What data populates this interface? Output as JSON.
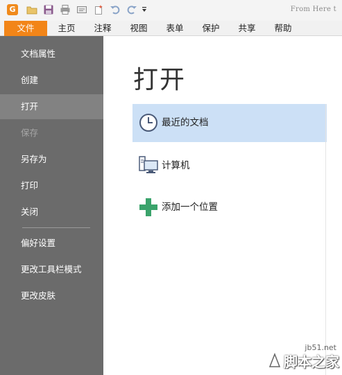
{
  "quick_access": {
    "app_logo_text": "G",
    "icons": [
      "folder-open-icon",
      "save-icon",
      "print-icon",
      "scan-icon",
      "new-document-icon",
      "undo-icon",
      "redo-icon",
      "customize-dropdown-icon"
    ],
    "hint": "From Here t"
  },
  "menu": {
    "tabs": [
      {
        "label": "文件",
        "active": true
      },
      {
        "label": "主页"
      },
      {
        "label": "注释"
      },
      {
        "label": "视图"
      },
      {
        "label": "表单"
      },
      {
        "label": "保护"
      },
      {
        "label": "共享"
      },
      {
        "label": "帮助"
      }
    ]
  },
  "sidebar": {
    "items": [
      {
        "label": "文档属性"
      },
      {
        "label": "创建"
      },
      {
        "label": "打开",
        "selected": true
      },
      {
        "label": "保存",
        "disabled": true
      },
      {
        "label": "另存为"
      },
      {
        "label": "打印"
      },
      {
        "label": "关闭"
      },
      {
        "label": "偏好设置"
      },
      {
        "label": "更改工具栏模式"
      },
      {
        "label": "更改皮肤"
      }
    ]
  },
  "main": {
    "title": "打开",
    "open_options": [
      {
        "label": "最近的文档",
        "icon": "clock-icon",
        "selected": true
      },
      {
        "label": "计算机",
        "icon": "computer-icon"
      },
      {
        "label": "添加一个位置",
        "icon": "plus-icon"
      }
    ]
  },
  "watermark": {
    "url": "jb51.net",
    "brand": "脚本之家"
  },
  "colors": {
    "accent_orange": "#f28518",
    "sidebar_bg": "#6b6b6b",
    "sidebar_selected": "#828282",
    "selected_item_bg": "#cce0f6",
    "plus_green": "#3aa36b"
  }
}
